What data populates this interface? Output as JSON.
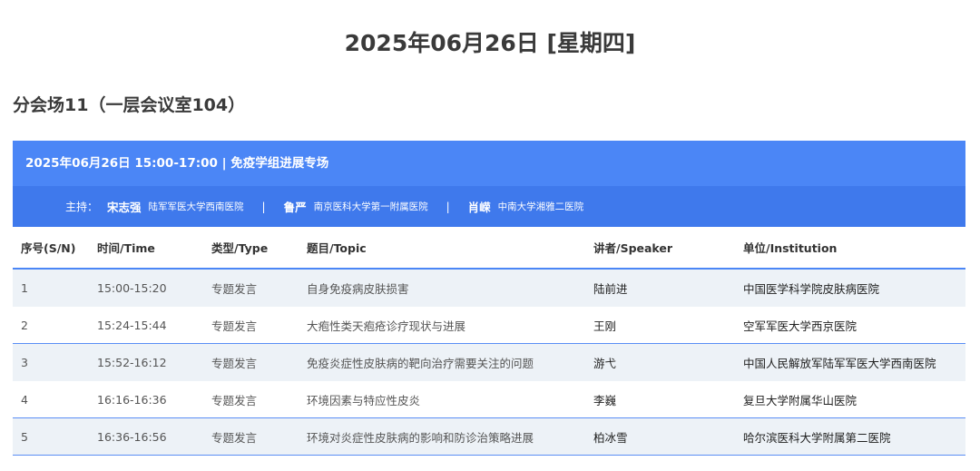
{
  "page": {
    "date_title": "2025年06月26日 [星期四]",
    "venue_title": "分会场11（一层会议室104）"
  },
  "session": {
    "header": "2025年06月26日 15:00-17:00 | 免疫学组进展专场",
    "chair_label": "主持：",
    "separator": "|",
    "chairs": [
      {
        "name": "宋志强",
        "institution": "陆军军医大学西南医院"
      },
      {
        "name": "鲁严",
        "institution": "南京医科大学第一附属医院"
      },
      {
        "name": "肖嵘",
        "institution": "中南大学湘雅二医院"
      }
    ]
  },
  "table": {
    "headers": {
      "sn": "序号(S/N)",
      "time": "时间/Time",
      "type": "类型/Type",
      "topic": "题目/Topic",
      "speaker": "讲者/Speaker",
      "institution": "单位/Institution"
    },
    "rows": [
      {
        "sn": "1",
        "time": "15:00-15:20",
        "type": "专题发言",
        "topic": "自身免疫病皮肤损害",
        "speaker": "陆前进",
        "institution": "中国医学科学院皮肤病医院"
      },
      {
        "sn": "2",
        "time": "15:24-15:44",
        "type": "专题发言",
        "topic": "大疱性类天疱疮诊疗现状与进展",
        "speaker": "王刚",
        "institution": "空军军医大学西京医院"
      },
      {
        "sn": "3",
        "time": "15:52-16:12",
        "type": "专题发言",
        "topic": "免疫炎症性皮肤病的靶向治疗需要关注的问题",
        "speaker": "游弋",
        "institution": "中国人民解放军陆军军医大学西南医院"
      },
      {
        "sn": "4",
        "time": "16:16-16:36",
        "type": "专题发言",
        "topic": "环境因素与特应性皮炎",
        "speaker": "李巍",
        "institution": "复旦大学附属华山医院"
      },
      {
        "sn": "5",
        "time": "16:36-16:56",
        "type": "专题发言",
        "topic": "环境对炎症性皮肤病的影响和防诊治策略进展",
        "speaker": "柏冰雪",
        "institution": "哈尔滨医科大学附属第二医院"
      }
    ]
  },
  "colors": {
    "header_blue": "#4b86f6",
    "chair_blue": "#3f79ec",
    "row_shade": "#edf2f7"
  }
}
